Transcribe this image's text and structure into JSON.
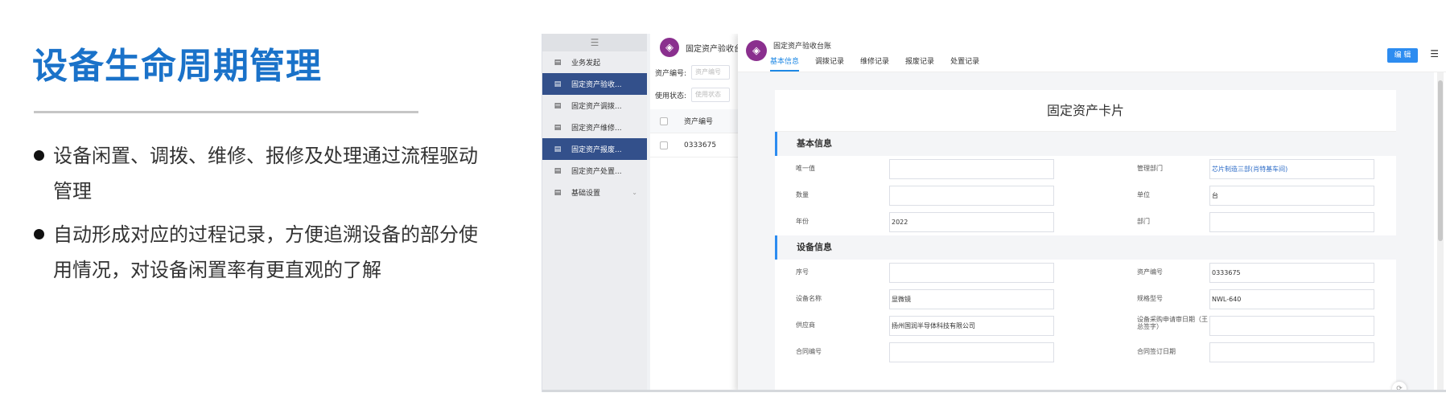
{
  "slide": {
    "title": "设备生命周期管理",
    "bullets": [
      "设备闲置、调拨、维修、报修及处理通过流程驱动管理",
      "自动形成对应的过程记录，方便追溯设备的部分使用情况，对设备闲置率有更直观的了解"
    ]
  },
  "sidebar": {
    "menu_icon": "☰",
    "items": [
      {
        "label": "业务发起",
        "icon": "document-icon"
      },
      {
        "label": "固定资产验收...",
        "icon": "document-icon"
      },
      {
        "label": "固定资产调拨...",
        "icon": "document-icon"
      },
      {
        "label": "固定资产维修...",
        "icon": "document-icon"
      },
      {
        "label": "固定资产报废...",
        "icon": "document-icon"
      },
      {
        "label": "固定资产处置...",
        "icon": "document-icon"
      },
      {
        "label": "基础设置",
        "icon": "document-icon"
      }
    ]
  },
  "list_panel": {
    "title": "固定资产验收台",
    "filter1_label": "资产编号:",
    "filter1_placeholder": "资产编号",
    "filter2_label": "使用状态:",
    "filter2_placeholder": "使用状态",
    "column": "资产编号",
    "rows": [
      "0333675"
    ]
  },
  "drawer": {
    "title": "固定资产验收台账",
    "tabs": [
      "基本信息",
      "调拨记录",
      "维修记录",
      "报废记录",
      "处置记录"
    ],
    "edit_label": "编 辑",
    "card_title": "固定资产卡片",
    "sections": [
      {
        "title": "基本信息",
        "rows": [
          [
            {
              "label": "唯一值",
              "value": ""
            },
            {
              "label": "管理部门",
              "value": "芯片制造三部(肖特基车间)"
            }
          ],
          [
            {
              "label": "数量",
              "value": ""
            },
            {
              "label": "单位",
              "value": "台"
            }
          ],
          [
            {
              "label": "年份",
              "value": "2022"
            },
            {
              "label": "部门",
              "value": ""
            }
          ]
        ]
      },
      {
        "title": "设备信息",
        "rows": [
          [
            {
              "label": "序号",
              "value": ""
            },
            {
              "label": "资产编号",
              "value": "0333675"
            }
          ],
          [
            {
              "label": "设备名称",
              "value": "显微镜"
            },
            {
              "label": "规格型号",
              "value": "NWL-640"
            }
          ],
          [
            {
              "label": "供应商",
              "value": "扬州国润半导体科技有限公司"
            },
            {
              "label": "设备采购申请审日期（王总签字）",
              "value": ""
            }
          ],
          [
            {
              "label": "合同编号",
              "value": ""
            },
            {
              "label": "合同签订日期",
              "value": ""
            }
          ]
        ]
      }
    ]
  }
}
